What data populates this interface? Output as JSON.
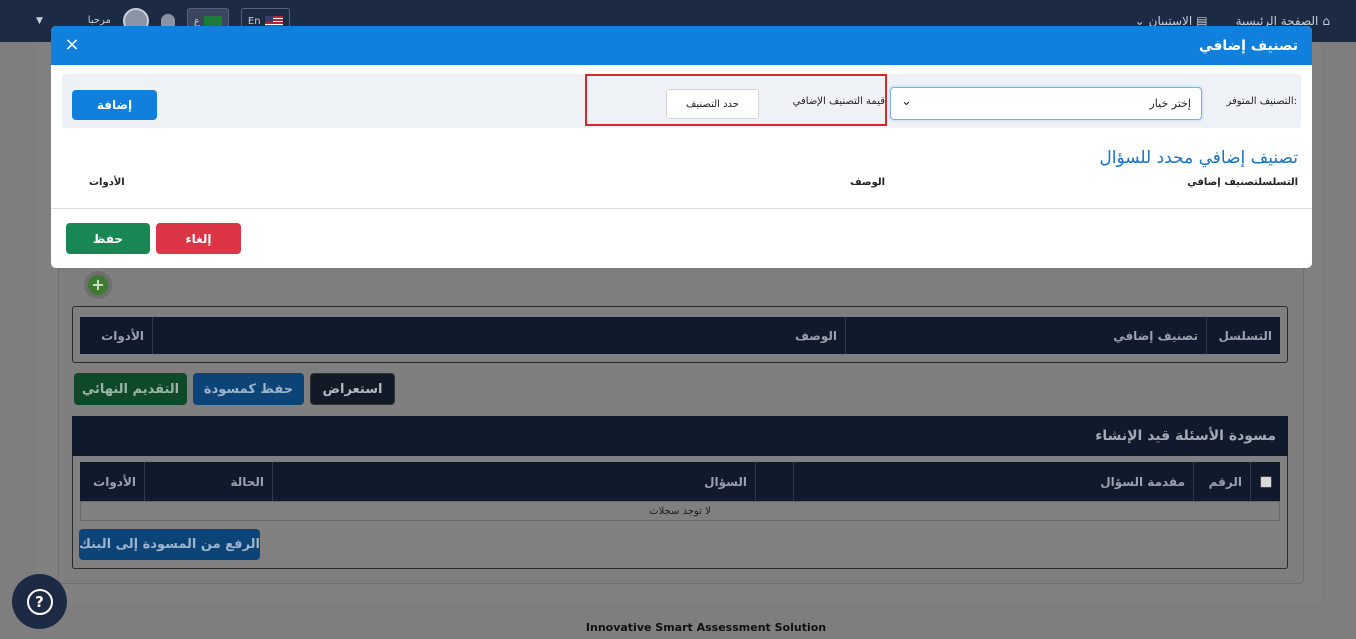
{
  "topbar": {
    "nav": [
      {
        "label": "الصفحة الرئيسية",
        "icon": "home-icon"
      },
      {
        "label": "الاستبيان",
        "icon": "survey-icon"
      }
    ],
    "lang_ar_label": "ع",
    "lang_en_label": "En",
    "greeting": "مرحبا"
  },
  "background": {
    "table1_headers": [
      "التسلسل",
      "تصنيف إضافي",
      "الوصف",
      "الأدوات"
    ],
    "buttons": {
      "preview": "استعراض",
      "save_draft": "حفظ كمسودة",
      "final_submit": "التقديم النهائي"
    },
    "draft_section_title": "مسودة الأسئلة قيد الإنشاء",
    "table2_headers": [
      "الرقم",
      "مقدمة السؤال",
      "السؤال",
      "الحالة",
      "الأدوات"
    ],
    "no_records": "لا توجد سجلات",
    "upload_button": "الرفع من المسودة إلى البنك"
  },
  "modal": {
    "title": "تصنيف إضافي",
    "available_label": "التصنيف المتوفر:",
    "select_value": "إختر خيار",
    "value_label": "قيمة التصنيف الإضافي",
    "pick_button": "حدد التصنيف",
    "add_button": "إضافة",
    "section_title": "تصنيف إضافي محدد للسؤال",
    "columns": {
      "seq": "التسلسلتصنيف إضافي",
      "desc": "الوصف",
      "tools": "الأدوات"
    },
    "cancel_button": "إلغاء",
    "save_button": "حفظ"
  },
  "footer": "Innovative Smart Assessment Solution",
  "colors": {
    "primary": "#1180dd",
    "danger": "#dc3545",
    "success": "#198754",
    "navy": "#1d2a44",
    "highlight": "#d62a2a"
  }
}
